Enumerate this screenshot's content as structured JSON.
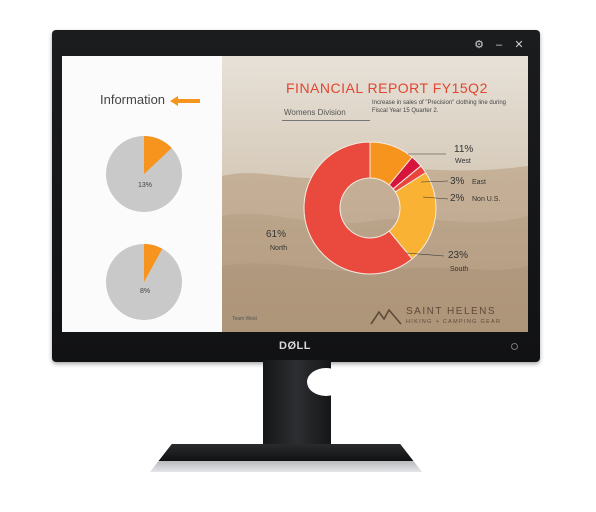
{
  "window": {
    "controls": [
      "⚙",
      "–",
      "✕"
    ]
  },
  "left_panel": {
    "title": "Information",
    "pies": [
      {
        "label": "13%",
        "value": 13,
        "color": "#f7941d",
        "base": "#c9c9c9"
      },
      {
        "label": "8%",
        "value": 8,
        "color": "#f7941d",
        "base": "#c9c9c9"
      }
    ]
  },
  "report": {
    "title": "FINANCIAL REPORT FY15Q2",
    "division": "Womens Division",
    "description": "Increase in sales of \"Precision\" clothing line during Fiscal Year 15 Quarter 2.",
    "team": "Team West"
  },
  "chart_data": {
    "type": "pie",
    "categories": [
      "West",
      "East",
      "Non U.S.",
      "South",
      "North"
    ],
    "values": [
      11,
      3,
      2,
      23,
      61
    ],
    "labels": [
      "11%",
      "3%",
      "2%",
      "23%",
      "61%"
    ],
    "colors": [
      "#f7941d",
      "#d7143c",
      "#e8453c",
      "#f9b233",
      "#ea4a3e"
    ]
  },
  "brand": {
    "name": "SAINT HELENS",
    "tagline": "HIKING + CAMPING GEAR"
  },
  "monitor": {
    "logo": "DØLL"
  }
}
